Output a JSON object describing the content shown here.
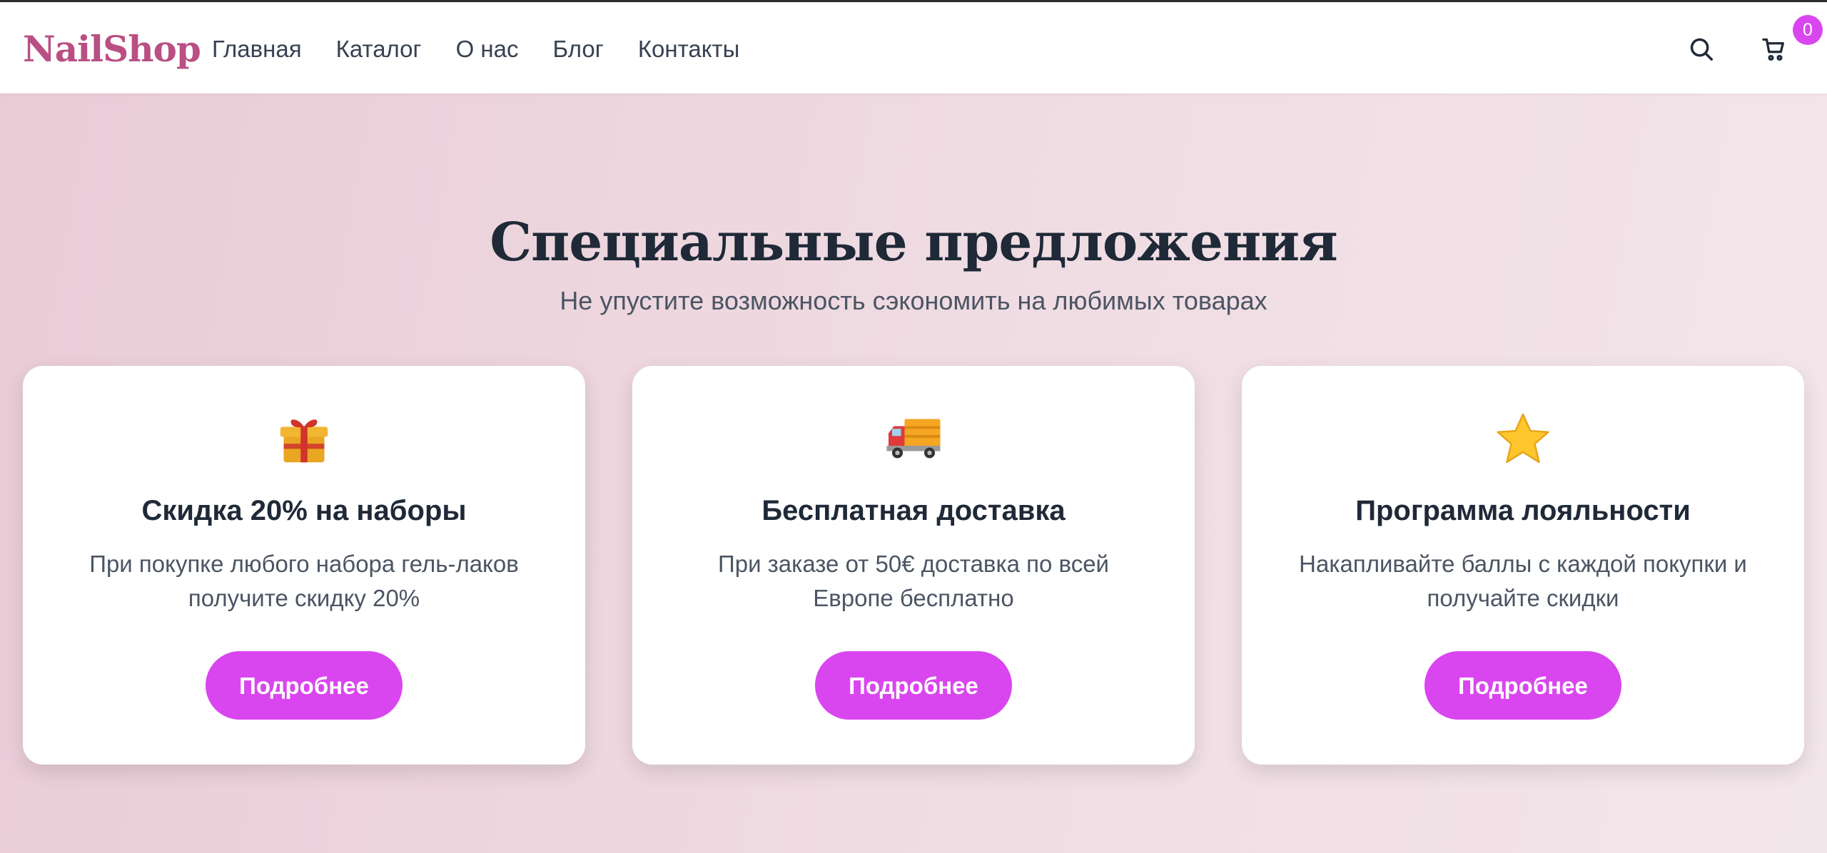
{
  "header": {
    "logo": "NailShop",
    "nav": [
      {
        "label": "Главная"
      },
      {
        "label": "Каталог"
      },
      {
        "label": "О нас"
      },
      {
        "label": "Блог"
      },
      {
        "label": "Контакты"
      }
    ],
    "search_icon": "search-icon",
    "cart_icon": "cart-icon",
    "cart_count": "0"
  },
  "section": {
    "title": "Специальные предложения",
    "subtitle": "Не упустите возможность сэкономить на любимых товарах"
  },
  "offers": [
    {
      "icon": "gift-icon",
      "title": "Скидка 20% на наборы",
      "text": "При покупке любого набора гель-лаков получите скидку 20%",
      "button": "Подробнее"
    },
    {
      "icon": "delivery-truck-icon",
      "title": "Бесплатная доставка",
      "text": "При заказе от 50€ доставка по всей Европе бесплатно",
      "button": "Подробнее"
    },
    {
      "icon": "star-icon",
      "title": "Программа лояльности",
      "text": "Накапливайте баллы с каждой покупки и получайте скидки",
      "button": "Подробнее"
    }
  ],
  "colors": {
    "brand": "#b94f83",
    "accent": "#d946ef",
    "heading": "#1f2937",
    "text": "#4b5563"
  }
}
